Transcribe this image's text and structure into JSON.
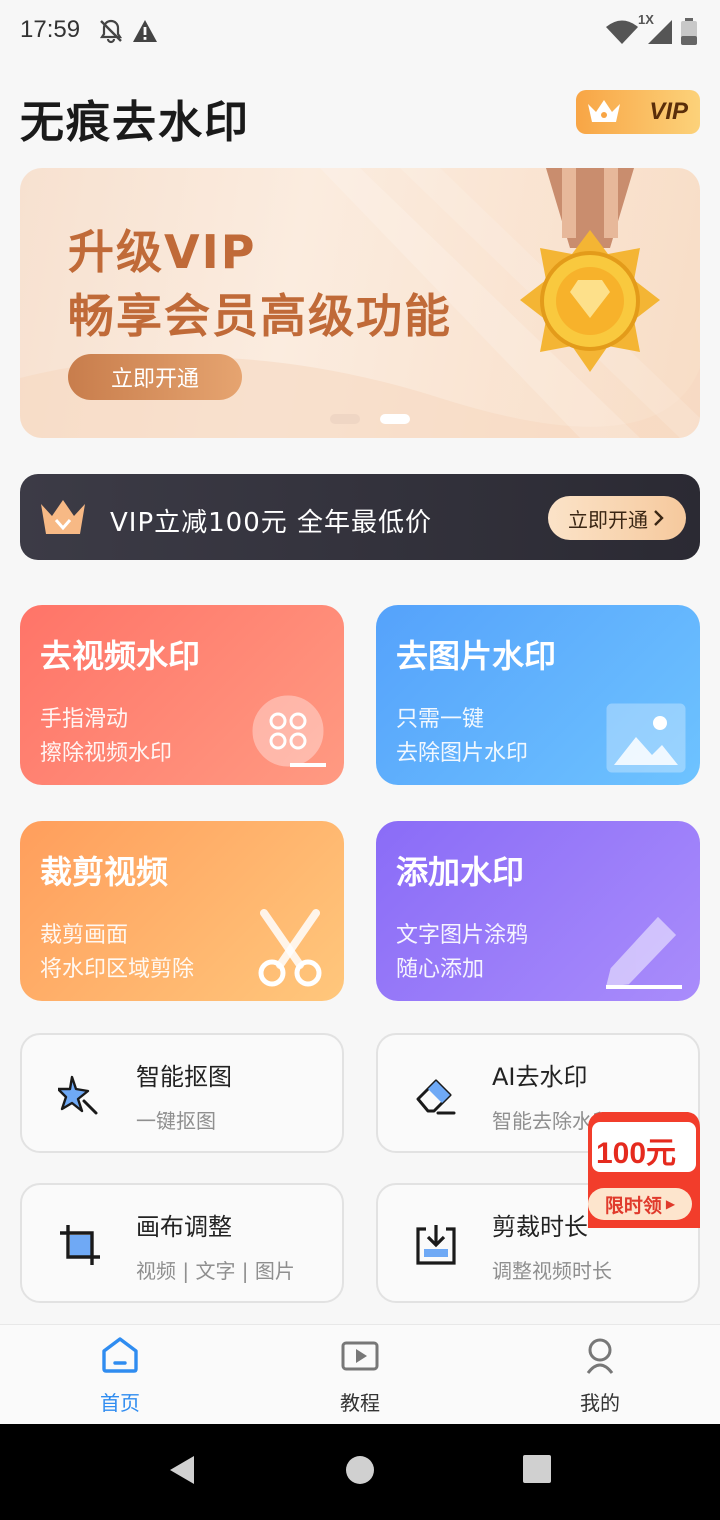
{
  "status_bar": {
    "time": "17:59",
    "network_badge": "1X",
    "icons": [
      "notifications-off-icon",
      "alert-icon",
      "wifi-icon",
      "signal-icon",
      "battery-icon"
    ]
  },
  "header": {
    "title": "无痕去水印",
    "vip_label": "VIP"
  },
  "banner": {
    "line1": "升级VIP",
    "line2": "畅享会员高级功能",
    "button": "立即开通",
    "page_count": 2,
    "active_page": 2
  },
  "promo": {
    "text": "VIP立减100元  全年最低价",
    "button": "立即开通"
  },
  "features": [
    {
      "title": "去视频水印",
      "desc1": "手指滑动",
      "desc2": "擦除视频水印",
      "icon": "film-reel-icon"
    },
    {
      "title": "去图片水印",
      "desc1": "只需一键",
      "desc2": "去除图片水印",
      "icon": "image-icon"
    },
    {
      "title": "裁剪视频",
      "desc1": "裁剪画面",
      "desc2": "将水印区域剪除",
      "icon": "scissors-icon"
    },
    {
      "title": "添加水印",
      "desc1": "文字图片涂鸦",
      "desc2": "随心添加",
      "icon": "pencil-icon"
    }
  ],
  "tools": [
    {
      "name": "智能抠图",
      "desc": "一键抠图",
      "icon": "magic-star-icon"
    },
    {
      "name": "AI去水印",
      "desc": "智能去除水印",
      "icon": "eraser-icon"
    },
    {
      "name": "画布调整",
      "desc": "视频 | 文字 | 图片",
      "icon": "crop-icon"
    },
    {
      "name": "剪裁时长",
      "desc": "调整视频时长",
      "icon": "download-trim-icon"
    }
  ],
  "coupon": {
    "amount": "100元",
    "label": "限时领"
  },
  "bottom_nav": [
    {
      "label": "首页",
      "icon": "home-icon",
      "active": true
    },
    {
      "label": "教程",
      "icon": "play-icon",
      "active": false
    },
    {
      "label": "我的",
      "icon": "profile-icon",
      "active": false
    }
  ],
  "colors": {
    "accent": "#2f8cf0",
    "vip_gold": "#f8a545",
    "coupon_red": "#e52a1e"
  }
}
